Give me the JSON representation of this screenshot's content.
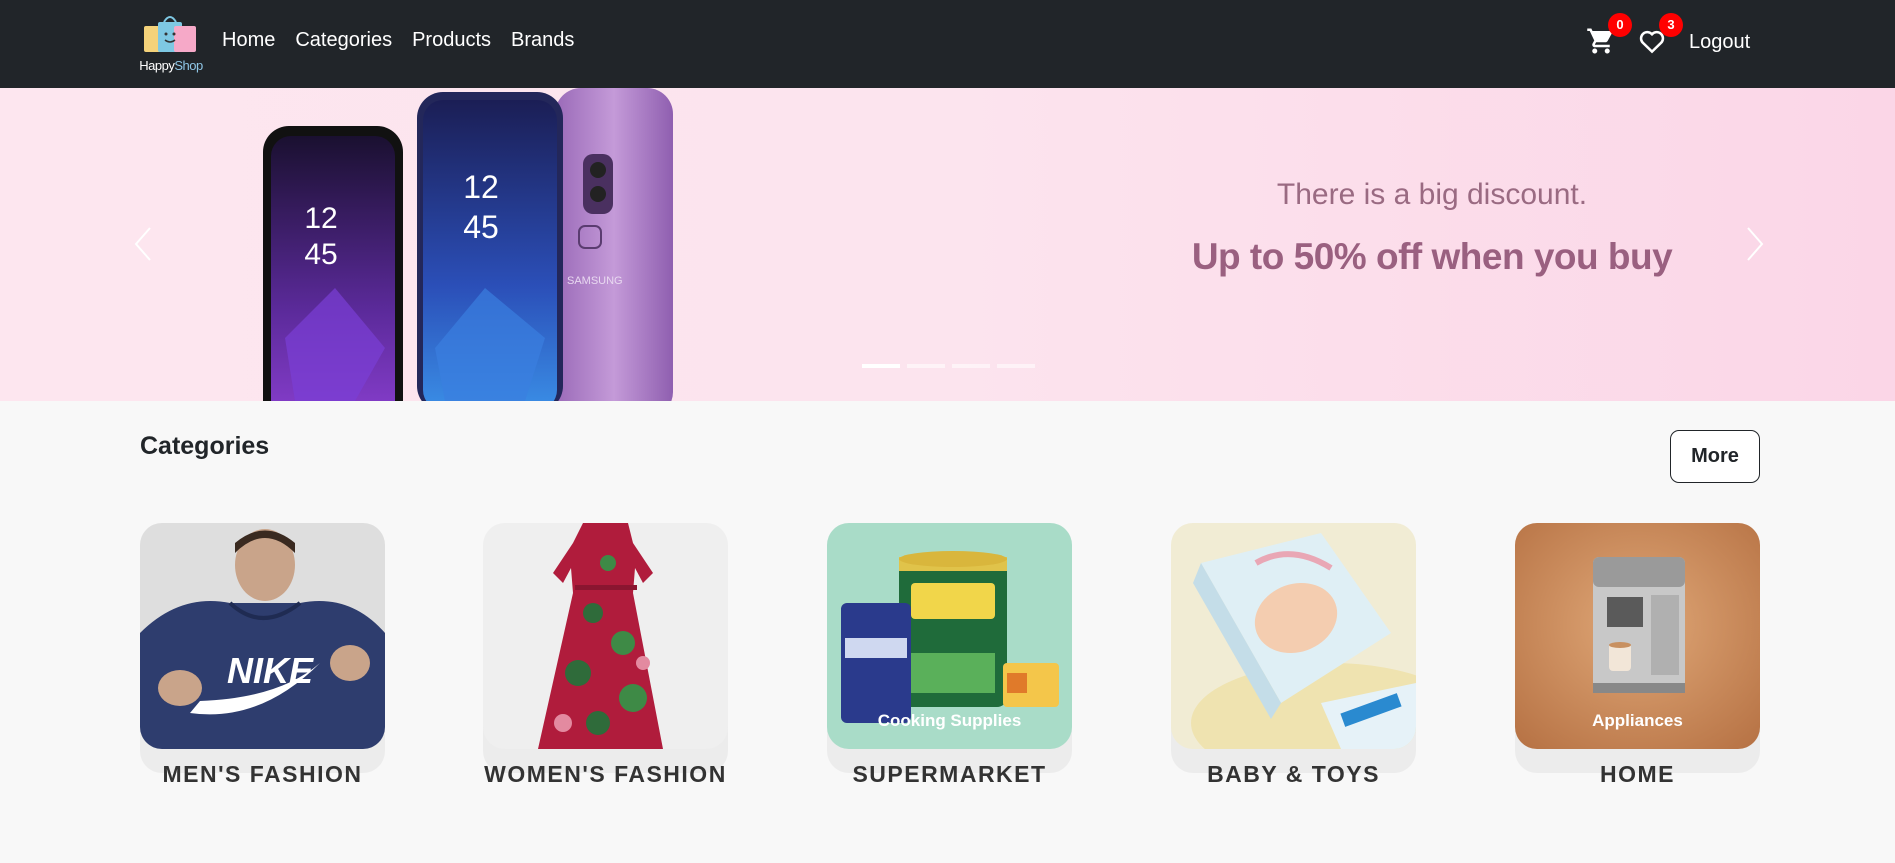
{
  "brand": {
    "logo_text_happy": "Happy",
    "logo_text_shop": "Shop",
    "logo_icon": "shopping-bags-icon"
  },
  "nav": {
    "links": [
      {
        "label": "Home"
      },
      {
        "label": "Categories"
      },
      {
        "label": "Products"
      },
      {
        "label": "Brands"
      }
    ],
    "cart": {
      "icon": "cart-icon",
      "count": "0"
    },
    "wishlist": {
      "icon": "heart-icon",
      "count": "3"
    },
    "logout_label": "Logout"
  },
  "hero": {
    "subtitle": "There is a big discount.",
    "title": "Up to 50% off when you buy",
    "phone_screen_time": "12\n45",
    "phone_brand": "SAMSUNG",
    "slides": 4,
    "active_slide": 1
  },
  "categories": {
    "title": "Categories",
    "more_label": "More",
    "items": [
      {
        "name": "MEN'S FASHION",
        "overlay": ""
      },
      {
        "name": "WOMEN'S FASHION",
        "overlay": ""
      },
      {
        "name": "SUPERMARKET",
        "overlay": "Cooking Supplies"
      },
      {
        "name": "BABY & TOYS",
        "overlay": ""
      },
      {
        "name": "HOME",
        "overlay": "Appliances"
      }
    ]
  },
  "colors": {
    "navbar": "#212529",
    "badge": "#ff0000",
    "hero_text": "#9a6080"
  }
}
